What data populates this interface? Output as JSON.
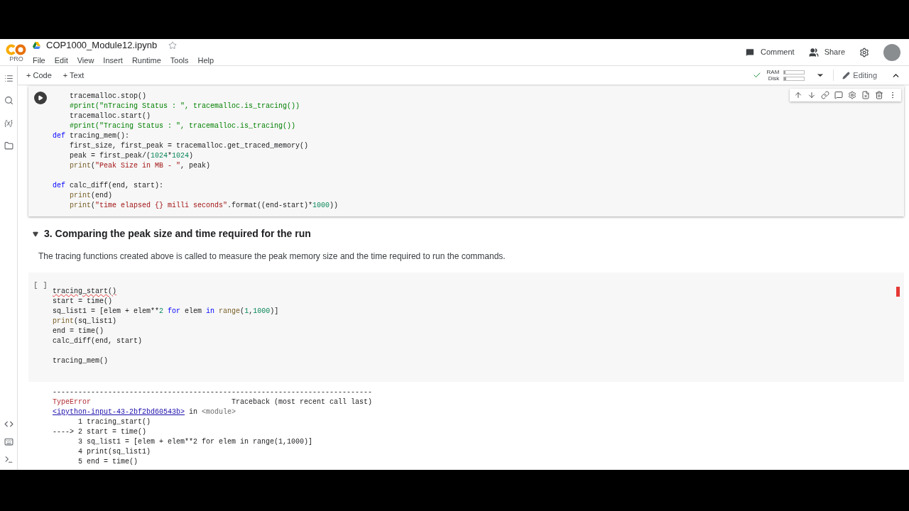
{
  "header": {
    "logo_text": "PRO",
    "title": "COP1000_Module12.ipynb",
    "starred": false,
    "menu": [
      "File",
      "Edit",
      "View",
      "Insert",
      "Runtime",
      "Tools",
      "Help"
    ],
    "actions": [
      {
        "kind": "comment",
        "label": "Comment"
      },
      {
        "kind": "share",
        "label": "Share"
      }
    ]
  },
  "sidebar": {
    "variables_label": "{x}"
  },
  "toolbar": {
    "add_buttons": [
      "+ Code",
      "+ Text"
    ],
    "resources": [
      {
        "label": "RAM",
        "level": 0.05
      },
      {
        "label": "Disk",
        "level": 0.1
      }
    ],
    "connected": true,
    "mode": "Editing"
  },
  "cells": [
    {
      "kind": "code",
      "executed": true,
      "blocks": [
        [
          [
            {
              "kind": "plain",
              "text": "    tracemalloc.stop()"
            }
          ],
          [
            {
              "kind": "comment",
              "text": "    #print(\"nTracing Status : \", tracemalloc.is_tracing())"
            }
          ],
          [
            {
              "kind": "plain",
              "text": "    tracemalloc.start()"
            }
          ],
          [
            {
              "kind": "comment",
              "text": "    #print(\"Tracing Status : \", tracemalloc.is_tracing())"
            }
          ],
          [
            {
              "kind": "keyword",
              "text": "def "
            },
            {
              "kind": "plain",
              "text": "tracing_mem():"
            }
          ],
          [
            {
              "kind": "plain",
              "text": "    first_size, first_peak = tracemalloc.get_traced_memory()"
            }
          ],
          [
            {
              "kind": "plain",
              "text": "    peak = first_peak/("
            },
            {
              "kind": "number",
              "text": "1024"
            },
            {
              "kind": "plain",
              "text": "*"
            },
            {
              "kind": "number",
              "text": "1024"
            },
            {
              "kind": "plain",
              "text": ")"
            }
          ],
          [
            {
              "kind": "builtin",
              "text": "    print"
            },
            {
              "kind": "plain",
              "text": "("
            },
            {
              "kind": "string",
              "text": "\"Peak Size in MB - \""
            },
            {
              "kind": "plain",
              "text": ", peak)"
            }
          ]
        ],
        [
          [
            {
              "kind": "keyword",
              "text": "def "
            },
            {
              "kind": "plain",
              "text": "calc_diff(end, start):"
            }
          ],
          [
            {
              "kind": "builtin",
              "text": "    print"
            },
            {
              "kind": "plain",
              "text": "(end)"
            }
          ],
          [
            {
              "kind": "builtin",
              "text": "    print"
            },
            {
              "kind": "plain",
              "text": "("
            },
            {
              "kind": "string",
              "text": "\"time elapsed {} milli seconds\""
            },
            {
              "kind": "plain",
              "text": ".format((end-start)*"
            },
            {
              "kind": "number",
              "text": "1000"
            },
            {
              "kind": "plain",
              "text": "))"
            }
          ]
        ]
      ]
    },
    {
      "kind": "text",
      "expanded": true,
      "heading": "3. Comparing the peak size and time required for the run",
      "body": "The tracing functions created above is called to measure the peak memory size and the time required to run the commands."
    },
    {
      "kind": "code",
      "executed": false,
      "run_label": "[ ]",
      "blocks": [
        [
          [
            {
              "kind": "error",
              "text": "tracing_start()"
            }
          ],
          [
            {
              "kind": "plain",
              "text": "start = time()"
            }
          ],
          [
            {
              "kind": "plain",
              "text": "sq_list1 = [elem + elem**"
            },
            {
              "kind": "number",
              "text": "2"
            },
            {
              "kind": "keyword",
              "text": " for "
            },
            {
              "kind": "plain",
              "text": "elem "
            },
            {
              "kind": "keyword",
              "text": "in "
            },
            {
              "kind": "builtin",
              "text": "range"
            },
            {
              "kind": "plain",
              "text": "("
            },
            {
              "kind": "number",
              "text": "1"
            },
            {
              "kind": "plain",
              "text": ","
            },
            {
              "kind": "number",
              "text": "1000"
            },
            {
              "kind": "plain",
              "text": ")]"
            }
          ],
          [
            {
              "kind": "builtin",
              "text": "print"
            },
            {
              "kind": "plain",
              "text": "(sq_list1)"
            }
          ],
          [
            {
              "kind": "plain",
              "text": "end = time()"
            }
          ],
          [
            {
              "kind": "plain",
              "text": "calc_diff(end, start)"
            }
          ]
        ],
        [
          [
            {
              "kind": "plain",
              "text": "tracing_mem()"
            }
          ]
        ]
      ],
      "output": [
        [
          {
            "kind": "plain",
            "text": "---------------------------------------------------------------------------"
          }
        ],
        [
          {
            "kind": "errname",
            "text": "TypeError"
          },
          {
            "kind": "plain",
            "text": "                                 Traceback (most recent call last)"
          }
        ],
        [
          {
            "kind": "link",
            "text": "<ipython-input-43-2bf2bd60543b>"
          },
          {
            "kind": "plain",
            "text": " in "
          },
          {
            "kind": "muted",
            "text": "<module>"
          }
        ],
        [
          {
            "kind": "plain",
            "text": "      1 tracing_start()"
          }
        ],
        [
          {
            "kind": "plain",
            "text": "----> 2 start = time()"
          }
        ],
        [
          {
            "kind": "plain",
            "text": "      3 sq_list1 = [elem + elem**2 for elem in range(1,1000)]"
          }
        ],
        [
          {
            "kind": "plain",
            "text": "      4 print(sq_list1)"
          }
        ],
        [
          {
            "kind": "plain",
            "text": "      5 end = time()"
          }
        ]
      ]
    }
  ]
}
